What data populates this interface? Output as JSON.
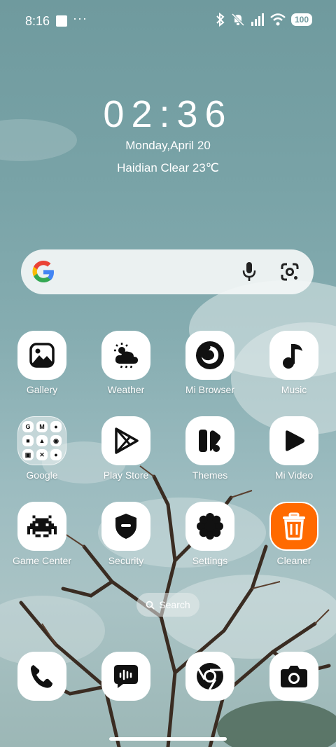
{
  "status_bar": {
    "time": "8:16",
    "dots": "···",
    "battery": "100"
  },
  "clock": {
    "time": "02:36",
    "date": "Monday,April 20",
    "weather": "Haidian Clear 23℃"
  },
  "search": {
    "google_icon": "google-g-icon",
    "mic_icon": "mic-icon",
    "lens_icon": "lens-icon"
  },
  "apps": [
    {
      "label": "Gallery",
      "icon": "gallery-icon"
    },
    {
      "label": "Weather",
      "icon": "weather-icon"
    },
    {
      "label": "Mi Browser",
      "icon": "browser-icon"
    },
    {
      "label": "Music",
      "icon": "music-note-icon"
    },
    {
      "label": "Google",
      "icon": "folder-icon"
    },
    {
      "label": "Play Store",
      "icon": "play-store-icon"
    },
    {
      "label": "Themes",
      "icon": "themes-icon"
    },
    {
      "label": "Mi Video",
      "icon": "video-play-icon"
    },
    {
      "label": "Game Center",
      "icon": "space-invader-icon"
    },
    {
      "label": "Security",
      "icon": "shield-icon"
    },
    {
      "label": "Settings",
      "icon": "gear-icon"
    },
    {
      "label": "Cleaner",
      "icon": "trash-icon"
    }
  ],
  "folder_items": [
    "G",
    "M",
    "●",
    "■",
    "▲",
    "◉",
    "▣",
    "✕",
    "●"
  ],
  "pill": {
    "label": "Search"
  },
  "dock": [
    {
      "icon": "phone-icon"
    },
    {
      "icon": "messages-icon"
    },
    {
      "icon": "chrome-icon"
    },
    {
      "icon": "camera-icon"
    }
  ],
  "colors": {
    "cleaner": "#ff6a00",
    "sky": "#7aa3a7"
  }
}
